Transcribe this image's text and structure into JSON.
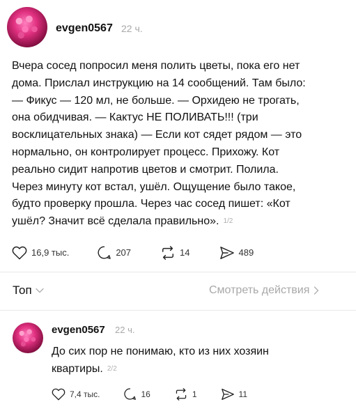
{
  "post": {
    "username": "evgen0567",
    "time": "22 ч.",
    "text_lines": [
      "Вчера сосед попросил меня полить цветы, пока его нет",
      "дома. Прислал инструкцию на 14 сообщений. Там было:",
      "— Фикус — 120 мл, не больше. — Орхидею не трогать,",
      "она обидчивая. — Кактус НЕ ПОЛИВАТЬ!!! (три",
      "восклицательных знака) — Если кот сядет рядом — это",
      "нормально, он контролирует процесс. Прихожу. Кот",
      "реально сидит напротив цветов и смотрит. Полила.",
      "Через минуту кот встал, ушёл. Ощущение было такое,",
      "будто проверку прошла. Через час сосед пишет: «Кот",
      "ушёл? Значит всё сделала правильно»."
    ],
    "page_indicator": "1/2",
    "likes": "16,9 тыс.",
    "comments": "207",
    "reposts": "14",
    "shares": "489"
  },
  "sort": {
    "label": "Топ",
    "view_actions": "Смотреть действия"
  },
  "reply": {
    "username": "evgen0567",
    "time": "22 ч.",
    "text_lines": [
      "До сих пор не понимаю, кто из них хозяин",
      "квартиры."
    ],
    "page_indicator": "2/2",
    "likes": "7,4 тыс.",
    "comments": "16",
    "reposts": "1",
    "shares": "11"
  },
  "icons": {
    "like": "heart-icon",
    "comment": "comment-bubble-icon",
    "repost": "repost-icon",
    "share": "send-icon",
    "dropdown": "chevron-down-icon",
    "forward": "chevron-right-icon"
  }
}
